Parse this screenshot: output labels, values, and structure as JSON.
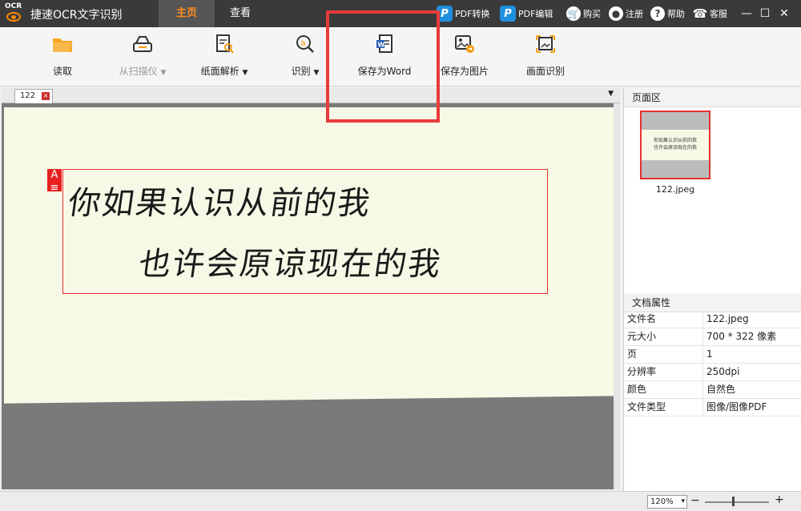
{
  "app": {
    "title": "捷速OCR文字识别",
    "logo_text": "OCR"
  },
  "tabs": [
    {
      "label": "主页",
      "active": true
    },
    {
      "label": "查看",
      "active": false
    }
  ],
  "topbar": {
    "pdf_convert": "PDF转换",
    "pdf_edit": "PDF编辑",
    "buy": "购买",
    "register": "注册",
    "help": "帮助",
    "service": "客服"
  },
  "ribbon": {
    "read": "读取",
    "from_scanner": "从扫描仪",
    "paper_parse": "纸面解析",
    "recognize": "识别",
    "save_word": "保存为Word",
    "save_image": "保存为图片",
    "screen_ocr": "画面识别"
  },
  "document": {
    "tab_label": "122",
    "line1": "你如果认识从前的我",
    "line2": "也许会原谅现在的我"
  },
  "pages_panel": {
    "title": "页面区",
    "thumb_caption": "122.jpeg"
  },
  "properties": {
    "title": "文档属性",
    "rows": [
      {
        "key": "文件名",
        "value": "122.jpeg"
      },
      {
        "key": "元大小",
        "value": "700 * 322 像素"
      },
      {
        "key": "页",
        "value": "1"
      },
      {
        "key": "分辨率",
        "value": "250dpi"
      },
      {
        "key": "颜色",
        "value": "自然色"
      },
      {
        "key": "文件类型",
        "value": "图像/图像PDF"
      }
    ]
  },
  "status": {
    "zoom": "120%"
  },
  "colors": {
    "accent": "#ff8c1a",
    "titlebar": "#3a3a3a",
    "highlight": "#e83b3b"
  }
}
